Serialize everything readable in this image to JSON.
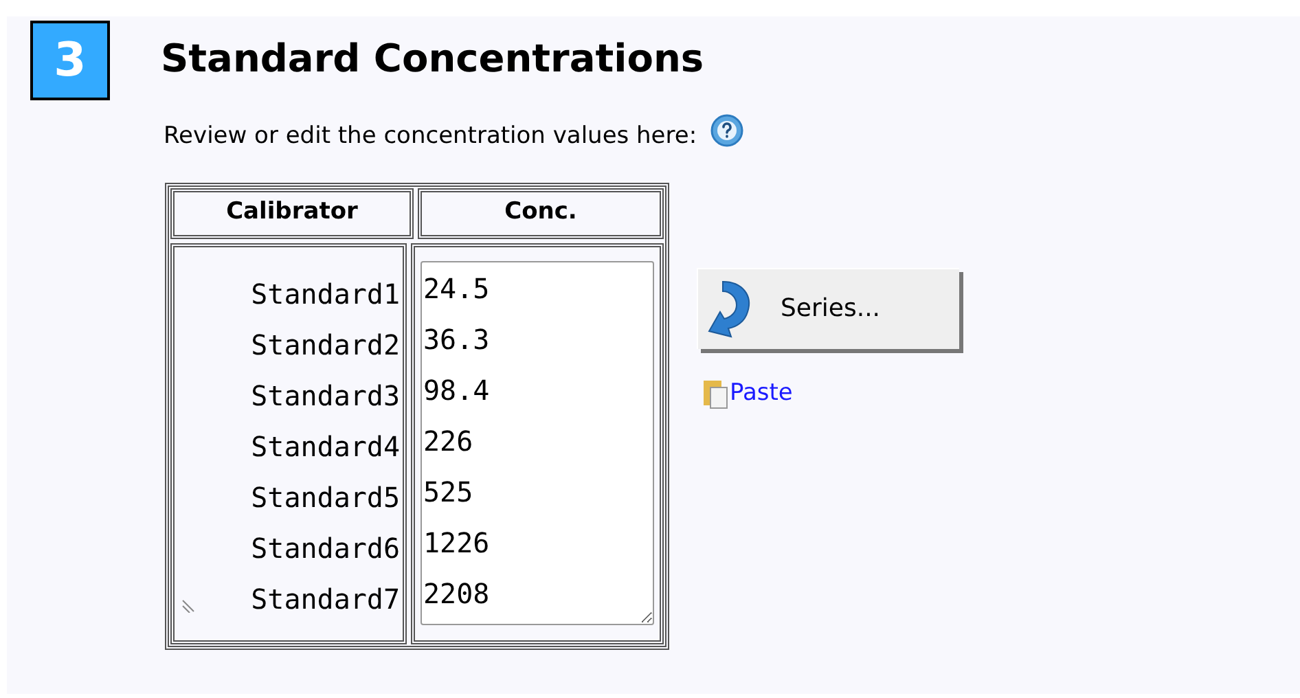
{
  "step": {
    "number": "3",
    "title": "Standard Concentrations"
  },
  "instruction": "Review or edit the concentration values here:",
  "table": {
    "columns": [
      "Calibrator",
      "Conc."
    ],
    "rows": [
      {
        "calibrator": "Standard1",
        "conc": "24.5"
      },
      {
        "calibrator": "Standard2",
        "conc": "36.3"
      },
      {
        "calibrator": "Standard3",
        "conc": "98.4"
      },
      {
        "calibrator": "Standard4",
        "conc": "226"
      },
      {
        "calibrator": "Standard5",
        "conc": "525"
      },
      {
        "calibrator": "Standard6",
        "conc": "1226"
      },
      {
        "calibrator": "Standard7",
        "conc": "2208"
      }
    ]
  },
  "buttons": [
    {
      "label": "Series..."
    }
  ],
  "links": [
    {
      "label": "Paste"
    }
  ]
}
